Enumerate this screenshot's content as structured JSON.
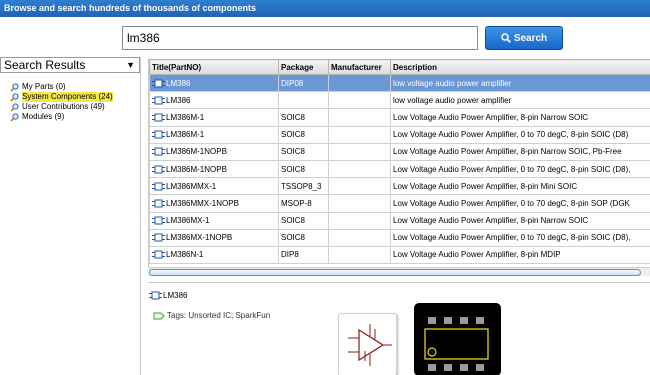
{
  "header": {
    "title": "Browse and search hundreds of thousands of components"
  },
  "search": {
    "value": "lm386",
    "button_label": "Search"
  },
  "results_dropdown": {
    "selected": "Search Results"
  },
  "tree": [
    {
      "label": "My Parts (0)",
      "icon": "magnifier-icon",
      "selected": false
    },
    {
      "label": "System Components (24)",
      "icon": "magnifier-icon",
      "selected": true
    },
    {
      "label": "User Contributions (49)",
      "icon": "magnifier-icon",
      "selected": false
    },
    {
      "label": "Modules (9)",
      "icon": "magnifier-icon",
      "selected": false
    }
  ],
  "table": {
    "columns": [
      "Title(PartNO)",
      "Package",
      "Manufacturer",
      "Description"
    ],
    "rows": [
      {
        "title": "LM386",
        "package": "DIP08",
        "manufacturer": "",
        "description": "low voltage audio power amplifier",
        "selected": true
      },
      {
        "title": "LM386",
        "package": "",
        "manufacturer": "",
        "description": "low voltage audio power amplifier",
        "selected": false
      },
      {
        "title": "LM386M-1",
        "package": "SOIC8",
        "manufacturer": "",
        "description": "Low Voltage Audio Power Amplifier, 8-pin Narrow SOIC",
        "selected": false
      },
      {
        "title": "LM386M-1",
        "package": "SOIC8",
        "manufacturer": "",
        "description": "Low Voltage Audio Power Amplifier, 0 to 70 degC, 8-pin SOIC (D8)",
        "selected": false
      },
      {
        "title": "LM386M-1NOPB",
        "package": "SOIC8",
        "manufacturer": "",
        "description": "Low Voltage Audio Power Amplifier, 8-pin Narrow SOIC, Pb-Free",
        "selected": false
      },
      {
        "title": "LM386M-1NOPB",
        "package": "SOIC8",
        "manufacturer": "",
        "description": "Low Voltage Audio Power Amplifier, 0 to 70 degC, 8-pin SOIC (D8),",
        "selected": false
      },
      {
        "title": "LM386MMX-1",
        "package": "TSSOP8_3",
        "manufacturer": "",
        "description": "Low Voltage Audio Power Amplifier, 8-pin Mini SOIC",
        "selected": false
      },
      {
        "title": "LM386MMX-1NOPB",
        "package": "MSOP-8",
        "manufacturer": "",
        "description": "Low Voltage Audio Power Amplifier, 0 to 70 degC, 8-pin SOP (DGK",
        "selected": false
      },
      {
        "title": "LM386MX-1",
        "package": "SOIC8",
        "manufacturer": "",
        "description": "Low Voltage Audio Power Amplifier, 8-pin Narrow SOIC",
        "selected": false
      },
      {
        "title": "LM386MX-1NOPB",
        "package": "SOIC8",
        "manufacturer": "",
        "description": "Low Voltage Audio Power Amplifier, 0 to 70 degC, 8-pin SOIC (D8),",
        "selected": false
      },
      {
        "title": "LM386N-1",
        "package": "DIP8",
        "manufacturer": "",
        "description": "Low Voltage Audio Power Amplifier, 8-pin MDIP",
        "selected": false
      }
    ]
  },
  "detail": {
    "title": "LM386",
    "tags": "Tags: Unsorted IC; SparkFun"
  },
  "colors": {
    "title_bar": "#1f63b6",
    "selected_row": "#6b97d6",
    "selected_tree": "#f6e74a",
    "search_button": "#1768c9"
  }
}
